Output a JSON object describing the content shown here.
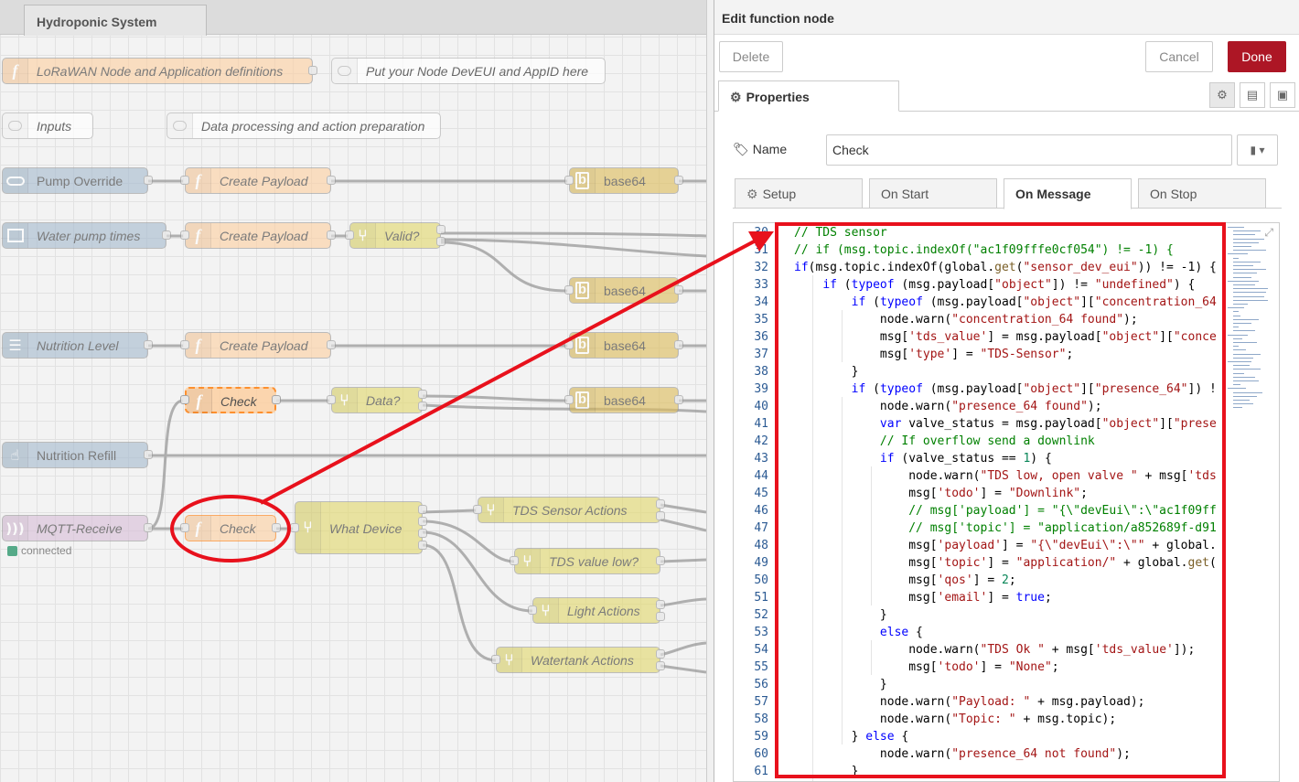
{
  "flow_tab": "Hydroponic System",
  "nodes": {
    "lorawan": "LoRaWAN Node and Application definitions",
    "put_devui": "Put your Node DevEUI and AppID here",
    "inputs": "Inputs",
    "data_processing": "Data processing and action preparation",
    "pump_override": "Pump Override",
    "create_payload": "Create Payload",
    "base64": "base64",
    "water_pump": "Water pump times",
    "valid": "Valid?",
    "nutrition_level": "Nutrition Level",
    "check": "Check",
    "data": "Data?",
    "nutrition_refill": "Nutrition Refill",
    "mqtt_receive": "MQTT-Receive",
    "connected": "connected",
    "what_device": "What Device",
    "tds_actions": "TDS Sensor Actions",
    "tds_low": "TDS value low?",
    "light_actions": "Light Actions",
    "watertank_actions": "Watertank Actions"
  },
  "tray": {
    "title": "Edit function node",
    "delete": "Delete",
    "cancel": "Cancel",
    "done": "Done",
    "properties_tab": "Properties",
    "name_label": "Name",
    "name_value": "Check",
    "tabs": [
      "Setup",
      "On Start",
      "On Message",
      "On Stop"
    ]
  },
  "code": {
    "line_numbers": [
      "30",
      "31",
      "32",
      "33",
      "34",
      "35",
      "36",
      "37",
      "38",
      "39",
      "40",
      "41",
      "42",
      "43",
      "44",
      "45",
      "46",
      "47",
      "48",
      "49",
      "50",
      "51",
      "52",
      "53",
      "54",
      "55",
      "56",
      "57",
      "58",
      "59",
      "60",
      "61"
    ],
    "lines": [
      [
        [
          "cm",
          "// TDS sensor"
        ]
      ],
      [
        [
          "cm",
          "// if (msg.topic.indexOf(\"ac1f09fffe0cf054\") != -1) {"
        ]
      ],
      [
        [
          "kw",
          "if"
        ],
        [
          "",
          "(msg.topic.indexOf(global."
        ],
        [
          "fnc",
          "get"
        ],
        [
          "",
          "("
        ],
        [
          "st",
          "\"sensor_dev_eui\""
        ],
        [
          "",
          ")) != -1) {"
        ]
      ],
      [
        [
          "",
          "    "
        ],
        [
          "kw",
          "if"
        ],
        [
          "",
          " ("
        ],
        [
          "kw",
          "typeof"
        ],
        [
          "",
          " (msg.payload["
        ],
        [
          "st",
          "\"object\""
        ],
        [
          "",
          "]) != "
        ],
        [
          "st",
          "\"undefined\""
        ],
        [
          "",
          ") {"
        ]
      ],
      [
        [
          "",
          "        "
        ],
        [
          "kw",
          "if"
        ],
        [
          "",
          " ("
        ],
        [
          "kw",
          "typeof"
        ],
        [
          "",
          " (msg.payload["
        ],
        [
          "st",
          "\"object\""
        ],
        [
          "",
          "]["
        ],
        [
          "st",
          "\"concentration_64"
        ]
      ],
      [
        [
          "",
          "            node.warn("
        ],
        [
          "st",
          "\"concentration_64 found\""
        ],
        [
          "",
          ");"
        ]
      ],
      [
        [
          "",
          "            msg["
        ],
        [
          "st",
          "'tds_value'"
        ],
        [
          "",
          "] = msg.payload["
        ],
        [
          "st",
          "\"object\""
        ],
        [
          "",
          "]["
        ],
        [
          "st",
          "\"conce"
        ]
      ],
      [
        [
          "",
          "            msg["
        ],
        [
          "st",
          "'type'"
        ],
        [
          "",
          "] = "
        ],
        [
          "st",
          "\"TDS-Sensor\""
        ],
        [
          "",
          ";"
        ]
      ],
      [
        [
          "",
          "        }"
        ]
      ],
      [
        [
          "",
          "        "
        ],
        [
          "kw",
          "if"
        ],
        [
          "",
          " ("
        ],
        [
          "kw",
          "typeof"
        ],
        [
          "",
          " (msg.payload["
        ],
        [
          "st",
          "\"object\""
        ],
        [
          "",
          "]["
        ],
        [
          "st",
          "\"presence_64\""
        ],
        [
          "",
          "]) !"
        ]
      ],
      [
        [
          "",
          "            node.warn("
        ],
        [
          "st",
          "\"presence_64 found\""
        ],
        [
          "",
          ");"
        ]
      ],
      [
        [
          "",
          "            "
        ],
        [
          "kw",
          "var"
        ],
        [
          "",
          " valve_status = msg.payload["
        ],
        [
          "st",
          "\"object\""
        ],
        [
          "",
          "]["
        ],
        [
          "st",
          "\"prese"
        ]
      ],
      [
        [
          "",
          "            "
        ],
        [
          "cm",
          "// If overflow send a downlink"
        ]
      ],
      [
        [
          "",
          "            "
        ],
        [
          "kw",
          "if"
        ],
        [
          "",
          " (valve_status == "
        ],
        [
          "nu",
          "1"
        ],
        [
          "",
          ") {"
        ]
      ],
      [
        [
          "",
          "                node.warn("
        ],
        [
          "st",
          "\"TDS low, open valve \""
        ],
        [
          "",
          " + msg["
        ],
        [
          "st",
          "'tds"
        ]
      ],
      [
        [
          "",
          "                msg["
        ],
        [
          "st",
          "'todo'"
        ],
        [
          "",
          "] = "
        ],
        [
          "st",
          "\"Downlink\""
        ],
        [
          "",
          ";"
        ]
      ],
      [
        [
          "",
          "                "
        ],
        [
          "cm",
          "// msg['payload'] = \"{\\\"devEui\\\":\\\"ac1f09ff"
        ]
      ],
      [
        [
          "",
          "                "
        ],
        [
          "cm",
          "// msg['topic'] = \"application/a852689f-d91"
        ]
      ],
      [
        [
          "",
          "                msg["
        ],
        [
          "st",
          "'payload'"
        ],
        [
          "",
          "] = "
        ],
        [
          "st",
          "\"{\\\"devEui\\\":\\\"\""
        ],
        [
          "",
          " + global."
        ]
      ],
      [
        [
          "",
          "                msg["
        ],
        [
          "st",
          "'topic'"
        ],
        [
          "",
          "] = "
        ],
        [
          "st",
          "\"application/\""
        ],
        [
          "",
          " + global."
        ],
        [
          "fnc",
          "get"
        ],
        [
          "",
          "("
        ]
      ],
      [
        [
          "",
          "                msg["
        ],
        [
          "st",
          "'qos'"
        ],
        [
          "",
          "] = "
        ],
        [
          "nu",
          "2"
        ],
        [
          "",
          ";"
        ]
      ],
      [
        [
          "",
          "                msg["
        ],
        [
          "st",
          "'email'"
        ],
        [
          "",
          "] = "
        ],
        [
          "kw",
          "true"
        ],
        [
          "",
          ";"
        ]
      ],
      [
        [
          "",
          "            }"
        ]
      ],
      [
        [
          "",
          "            "
        ],
        [
          "kw",
          "else"
        ],
        [
          "",
          " {"
        ]
      ],
      [
        [
          "",
          "                node.warn("
        ],
        [
          "st",
          "\"TDS Ok \""
        ],
        [
          "",
          " + msg["
        ],
        [
          "st",
          "'tds_value'"
        ],
        [
          "",
          "]);"
        ]
      ],
      [
        [
          "",
          "                msg["
        ],
        [
          "st",
          "'todo'"
        ],
        [
          "",
          "] = "
        ],
        [
          "st",
          "\"None\""
        ],
        [
          "",
          ";"
        ]
      ],
      [
        [
          "",
          "            }"
        ]
      ],
      [
        [
          "",
          "            node.warn("
        ],
        [
          "st",
          "\"Payload: \""
        ],
        [
          "",
          " + msg.payload);"
        ]
      ],
      [
        [
          "",
          "            node.warn("
        ],
        [
          "st",
          "\"Topic: \""
        ],
        [
          "",
          " + msg.topic);"
        ]
      ],
      [
        [
          "",
          "        } "
        ],
        [
          "kw",
          "else"
        ],
        [
          "",
          " {"
        ]
      ],
      [
        [
          "",
          "            node.warn("
        ],
        [
          "st",
          "\"presence_64 not found\""
        ],
        [
          "",
          ");"
        ]
      ],
      [
        [
          "",
          "        }"
        ]
      ]
    ]
  },
  "colors": {
    "highlight": "#e8111c",
    "done": "#ad1625",
    "selected": "#ff7f0e"
  }
}
